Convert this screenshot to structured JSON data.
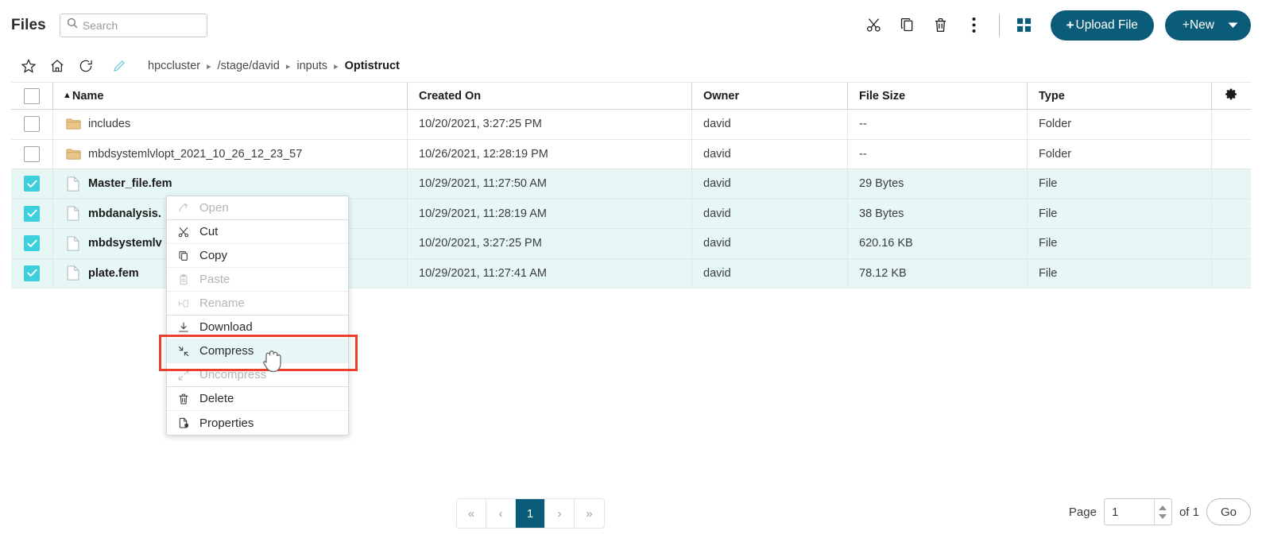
{
  "header": {
    "title": "Files",
    "search": {
      "placeholder": "Search",
      "value": ""
    },
    "actions": [
      {
        "name": "cut-icon",
        "label": "Cut"
      },
      {
        "name": "copy-icon",
        "label": "Copy"
      },
      {
        "name": "delete-icon",
        "label": "Delete"
      },
      {
        "name": "more-vertical-icon",
        "label": "More"
      },
      {
        "name": "grid-view-icon",
        "label": "Grid view"
      }
    ],
    "upload_label": "Upload File",
    "new_label": "New",
    "plus": "+"
  },
  "breadcrumb": {
    "icons": [
      {
        "name": "star-icon",
        "label": "Favorite"
      },
      {
        "name": "home-icon",
        "label": "Home"
      },
      {
        "name": "refresh-icon",
        "label": "Refresh"
      },
      {
        "name": "edit-path-icon",
        "label": "Edit path"
      }
    ],
    "separator": "▸",
    "items": [
      {
        "label": "hpccluster",
        "active": false
      },
      {
        "label": "/stage/david",
        "active": false
      },
      {
        "label": "inputs",
        "active": false
      },
      {
        "label": "Optistruct",
        "active": true
      }
    ]
  },
  "table": {
    "sort_caret": "▲",
    "columns": [
      "Name",
      "Created On",
      "Owner",
      "File Size",
      "Type"
    ],
    "settings_icon": "gear-icon",
    "rows": [
      {
        "name": "includes",
        "created": "10/20/2021, 3:27:25 PM",
        "owner": "david",
        "size": "--",
        "type": "Folder",
        "kind": "folder",
        "selected": false
      },
      {
        "name": "mbdsystemlvlopt_2021_10_26_12_23_57",
        "created": "10/26/2021, 12:28:19 PM",
        "owner": "david",
        "size": "--",
        "type": "Folder",
        "kind": "folder",
        "selected": false
      },
      {
        "name": "Master_file.fem",
        "created": "10/29/2021, 11:27:50 AM",
        "owner": "david",
        "size": "29 Bytes",
        "type": "File",
        "kind": "file",
        "selected": true
      },
      {
        "name": "mbdanalysis.",
        "created": "10/29/2021, 11:28:19 AM",
        "owner": "david",
        "size": "38 Bytes",
        "type": "File",
        "kind": "file",
        "selected": true
      },
      {
        "name": "mbdsystemlv",
        "created": "10/20/2021, 3:27:25 PM",
        "owner": "david",
        "size": "620.16 KB",
        "type": "File",
        "kind": "file",
        "selected": true
      },
      {
        "name": "plate.fem",
        "created": "10/29/2021, 11:27:41 AM",
        "owner": "david",
        "size": "78.12 KB",
        "type": "File",
        "kind": "file",
        "selected": true
      }
    ]
  },
  "context_menu": {
    "items": [
      {
        "label": "Open",
        "icon": "open-arrow-icon",
        "disabled": true,
        "highlighted": false
      },
      {
        "label": "Cut",
        "icon": "scissors-icon",
        "disabled": false,
        "highlighted": false
      },
      {
        "label": "Copy",
        "icon": "copy-icon",
        "disabled": false,
        "highlighted": false
      },
      {
        "label": "Paste",
        "icon": "clipboard-icon",
        "disabled": true,
        "highlighted": false
      },
      {
        "label": "Rename",
        "icon": "rename-icon",
        "disabled": true,
        "highlighted": false
      },
      {
        "label": "Download",
        "icon": "download-icon",
        "disabled": false,
        "highlighted": false
      },
      {
        "label": "Compress",
        "icon": "compress-icon",
        "disabled": false,
        "highlighted": true
      },
      {
        "label": "Uncompress",
        "icon": "uncompress-icon",
        "disabled": true,
        "highlighted": false
      },
      {
        "label": "Delete",
        "icon": "trash-icon",
        "disabled": false,
        "highlighted": false
      },
      {
        "label": "Properties",
        "icon": "properties-icon",
        "disabled": false,
        "highlighted": false
      }
    ]
  },
  "footer": {
    "pager": [
      {
        "label": "«",
        "name": "first-page-button",
        "current": false
      },
      {
        "label": "‹",
        "name": "prev-page-button",
        "current": false
      },
      {
        "label": "1",
        "name": "page-1-button",
        "current": true
      },
      {
        "label": "›",
        "name": "next-page-button",
        "current": false
      },
      {
        "label": "»",
        "name": "last-page-button",
        "current": false
      }
    ],
    "page_label": "Page",
    "page_value": "1",
    "of_label": "of 1",
    "go_label": "Go"
  },
  "colors": {
    "primary": "#0b5c78",
    "checkbox": "#3ccfdc",
    "selected_row": "#e7f7f6",
    "highlight_box": "#e8402a",
    "folder": "#e8c58a"
  }
}
